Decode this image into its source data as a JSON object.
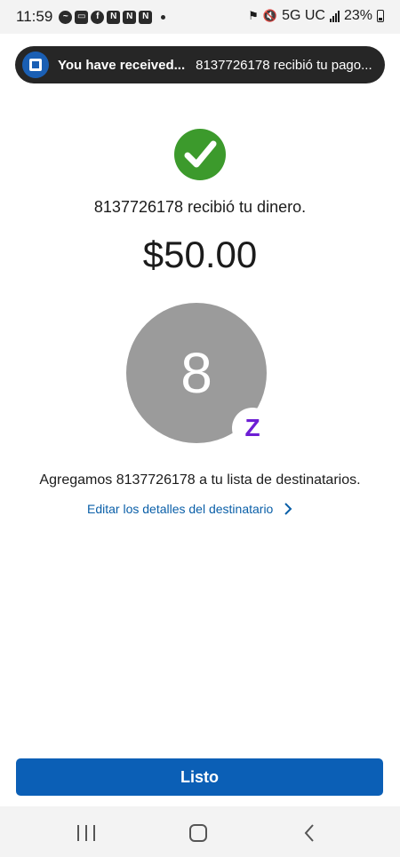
{
  "status_bar": {
    "time": "11:59",
    "network": "5G UC",
    "battery": "23%"
  },
  "notification": {
    "title": "You have received...",
    "body": "8137726178 recibió tu pago..."
  },
  "confirmation": {
    "message": "8137726178 recibió tu dinero.",
    "amount": "$50.00"
  },
  "recipient": {
    "initial": "8",
    "badge": "Z",
    "added_message": "Agregamos 8137726178 a tu lista de destinatarios.",
    "edit_link": "Editar los detalles del destinatario"
  },
  "actions": {
    "done_label": "Listo"
  },
  "colors": {
    "brand_blue": "#0b5fb6",
    "success_green": "#3c9a2c",
    "zelle_purple": "#6d1ed4",
    "avatar_gray": "#9b9b9b"
  },
  "icons": [
    "messenger-icon",
    "tv-icon",
    "facebook-icon",
    "nascar-icon",
    "check-icon",
    "zelle-icon",
    "chevron-right-icon",
    "mute-icon",
    "signal-icon",
    "battery-icon"
  ]
}
